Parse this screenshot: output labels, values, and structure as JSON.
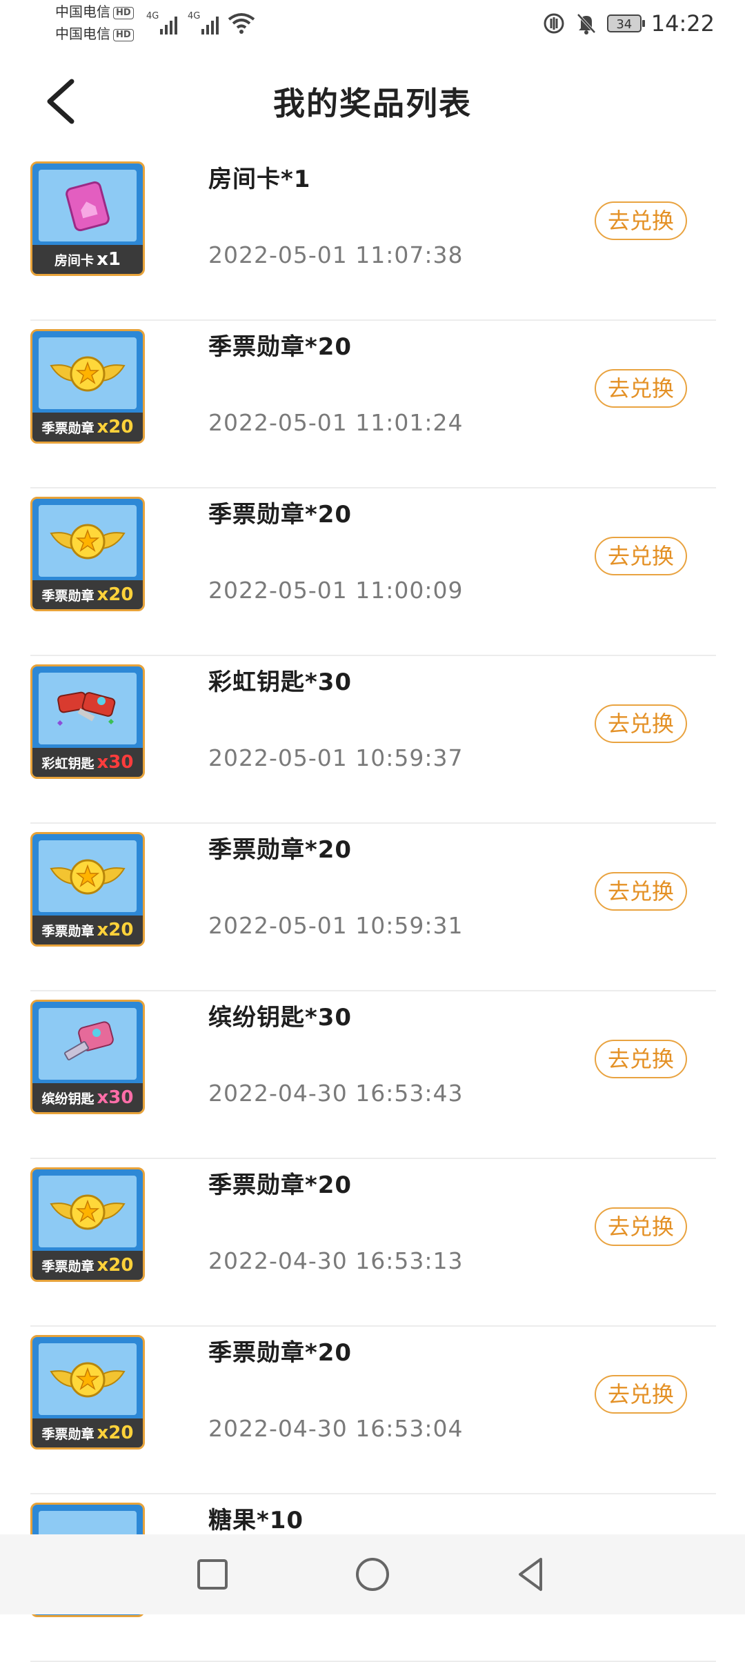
{
  "status_bar": {
    "carrier1": "中国电信",
    "carrier2": "中国电信",
    "hd": "HD",
    "network1": "4G",
    "network2": "4G",
    "battery": "34",
    "time": "14:22"
  },
  "header": {
    "title": "我的奖品列表"
  },
  "prizes": [
    {
      "name": "房间卡*1",
      "time": "2022-05-01 11:07:38",
      "button": "去兑换",
      "thumb_label": "房间卡",
      "thumb_qty": "x1",
      "icon": "room-card-icon",
      "qty_color": "white"
    },
    {
      "name": "季票勋章*20",
      "time": "2022-05-01 11:01:24",
      "button": "去兑换",
      "thumb_label": "季票勋章",
      "thumb_qty": "x20",
      "icon": "season-medal-icon",
      "qty_color": "gold"
    },
    {
      "name": "季票勋章*20",
      "time": "2022-05-01 11:00:09",
      "button": "去兑换",
      "thumb_label": "季票勋章",
      "thumb_qty": "x20",
      "icon": "season-medal-icon",
      "qty_color": "gold"
    },
    {
      "name": "彩虹钥匙*30",
      "time": "2022-05-01 10:59:37",
      "button": "去兑换",
      "thumb_label": "彩虹钥匙",
      "thumb_qty": "x30",
      "icon": "rainbow-key-icon",
      "qty_color": "red"
    },
    {
      "name": "季票勋章*20",
      "time": "2022-05-01 10:59:31",
      "button": "去兑换",
      "thumb_label": "季票勋章",
      "thumb_qty": "x20",
      "icon": "season-medal-icon",
      "qty_color": "gold"
    },
    {
      "name": "缤纷钥匙*30",
      "time": "2022-04-30 16:53:43",
      "button": "去兑换",
      "thumb_label": "缤纷钥匙",
      "thumb_qty": "x30",
      "icon": "colorful-key-icon",
      "qty_color": "pink"
    },
    {
      "name": "季票勋章*20",
      "time": "2022-04-30 16:53:13",
      "button": "去兑换",
      "thumb_label": "季票勋章",
      "thumb_qty": "x20",
      "icon": "season-medal-icon",
      "qty_color": "gold"
    },
    {
      "name": "季票勋章*20",
      "time": "2022-04-30 16:53:04",
      "button": "去兑换",
      "thumb_label": "季票勋章",
      "thumb_qty": "x20",
      "icon": "season-medal-icon",
      "qty_color": "gold"
    },
    {
      "name": "糖果*10",
      "time": "",
      "button": "",
      "thumb_label": "",
      "thumb_qty": "",
      "icon": "candy-icon",
      "qty_color": "gold"
    }
  ]
}
